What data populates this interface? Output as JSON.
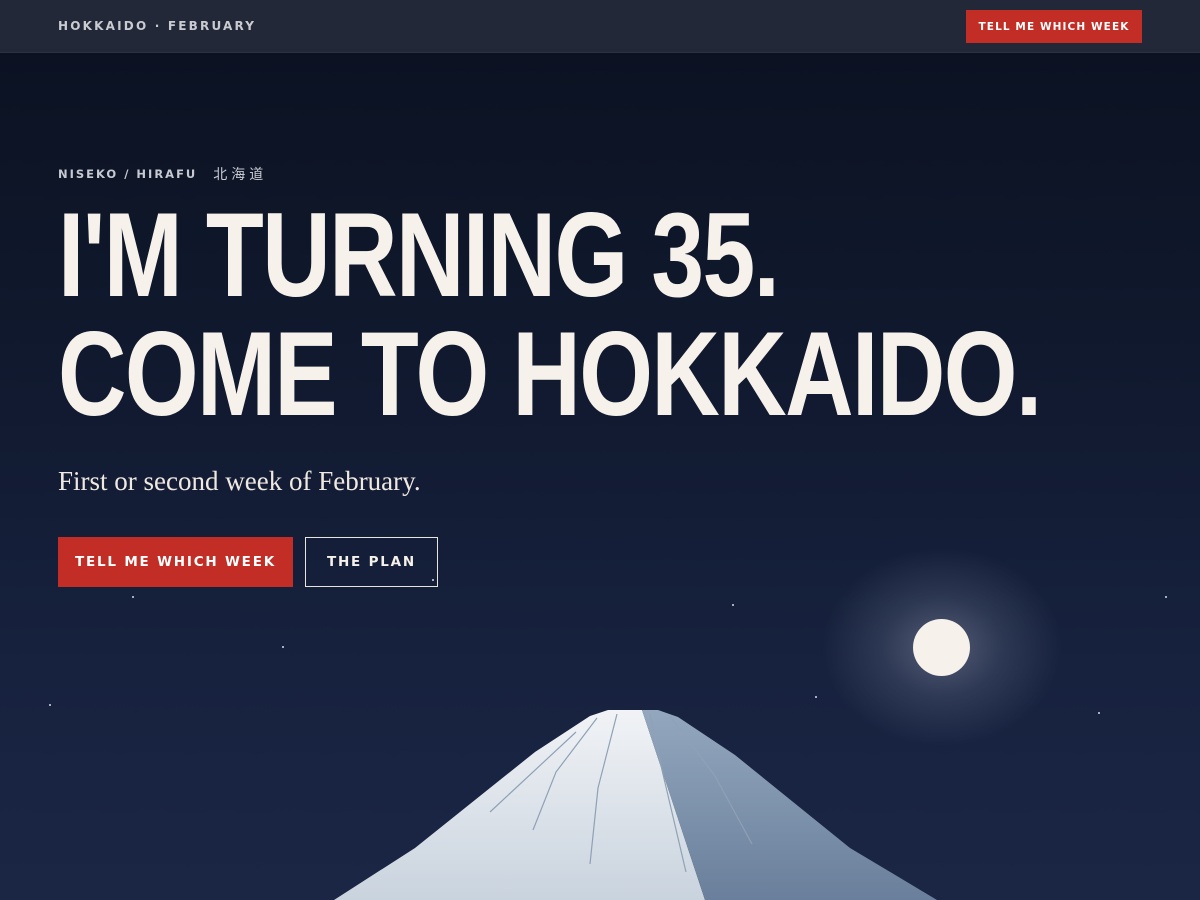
{
  "nav": {
    "brand": "HOKKAIDO · FEBRUARY",
    "cta_label": "TELL ME WHICH WEEK"
  },
  "hero": {
    "eyebrow_place": "NISEKO / HIRAFU",
    "eyebrow_kanji": "北海道",
    "headline_line1": "I'M TURNING 35.",
    "headline_line2": "COME TO HOKKAIDO.",
    "subhead": "First or second week of February.",
    "primary_button": "TELL ME WHICH WEEK",
    "secondary_button": "THE PLAN"
  },
  "scene": {
    "elements": [
      "mountain-illustration",
      "moon",
      "stars"
    ]
  },
  "colors": {
    "accent": "#c22e26",
    "text": "#f6f1ea",
    "background_top": "#0b1120",
    "background_bottom": "#1b2645"
  }
}
